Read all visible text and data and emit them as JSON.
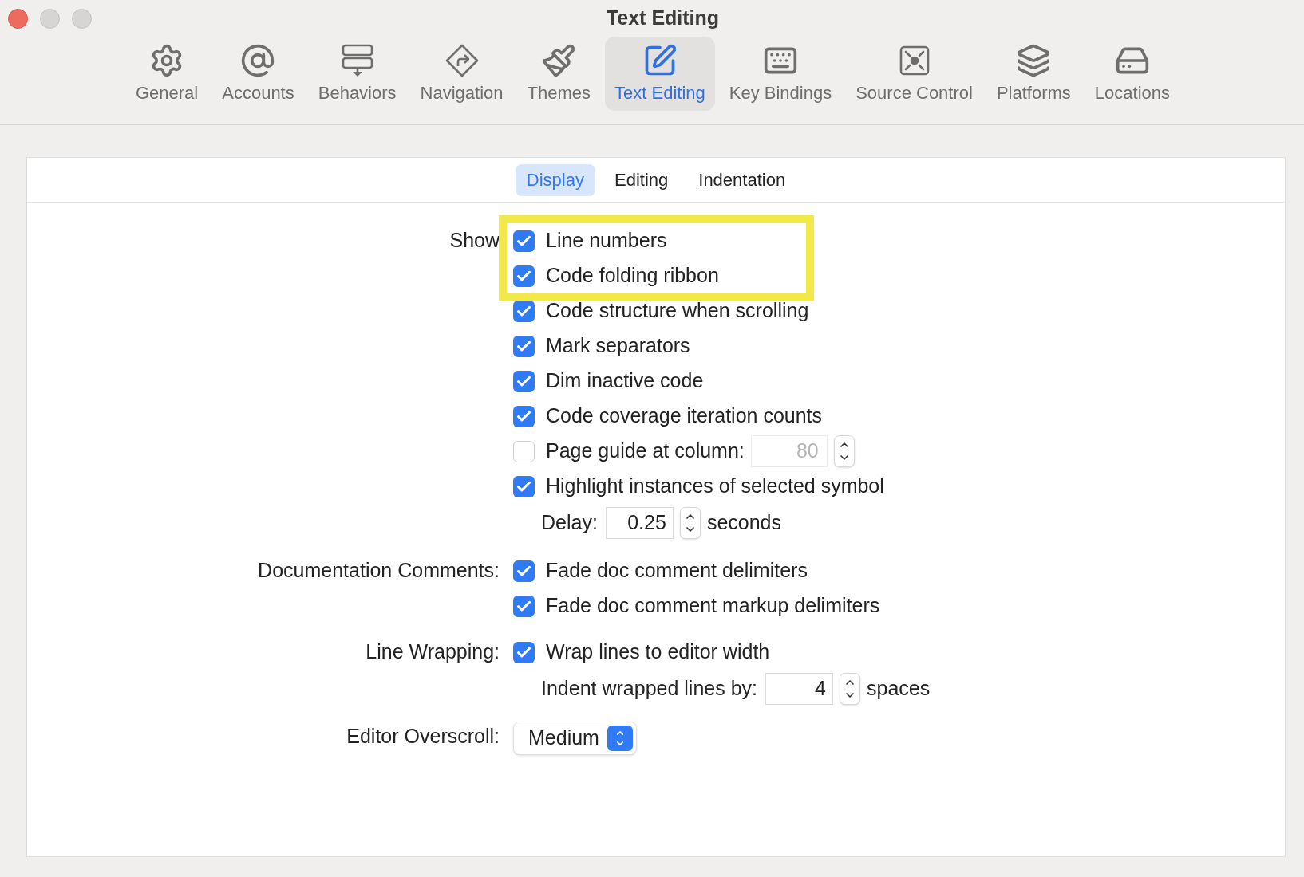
{
  "window": {
    "title": "Text Editing"
  },
  "toolbar": [
    {
      "label": "General",
      "selected": false
    },
    {
      "label": "Accounts",
      "selected": false
    },
    {
      "label": "Behaviors",
      "selected": false
    },
    {
      "label": "Navigation",
      "selected": false
    },
    {
      "label": "Themes",
      "selected": false
    },
    {
      "label": "Text Editing",
      "selected": true
    },
    {
      "label": "Key Bindings",
      "selected": false
    },
    {
      "label": "Source Control",
      "selected": false
    },
    {
      "label": "Platforms",
      "selected": false
    },
    {
      "label": "Locations",
      "selected": false
    }
  ],
  "tabs": [
    {
      "label": "Display",
      "selected": true
    },
    {
      "label": "Editing",
      "selected": false
    },
    {
      "label": "Indentation",
      "selected": false
    }
  ],
  "sections": [
    {
      "label": "Show",
      "items": [
        {
          "kind": "checkbox",
          "label": "Line numbers",
          "checked": true,
          "highlighted": true
        },
        {
          "kind": "checkbox",
          "label": "Code folding ribbon",
          "checked": true,
          "highlighted": true
        },
        {
          "kind": "checkbox",
          "label": "Code structure when scrolling",
          "checked": true,
          "highlighted": false
        },
        {
          "kind": "checkbox",
          "label": "Mark separators",
          "checked": true,
          "highlighted": false
        },
        {
          "kind": "checkbox",
          "label": "Dim inactive code",
          "checked": true,
          "highlighted": false
        },
        {
          "kind": "checkbox",
          "label": "Code coverage iteration counts",
          "checked": true,
          "highlighted": false
        },
        {
          "kind": "checkbox",
          "label": "Page guide at column:",
          "checked": false,
          "highlighted": false,
          "field": {
            "value": "80",
            "disabled": true
          }
        },
        {
          "kind": "checkbox",
          "label": "Highlight instances of selected symbol",
          "checked": true,
          "highlighted": false
        },
        {
          "kind": "stepper",
          "label": "Delay:",
          "value": "0.25",
          "unit": "seconds"
        }
      ]
    },
    {
      "label": "Documentation Comments:",
      "items": [
        {
          "kind": "checkbox",
          "label": "Fade doc comment delimiters",
          "checked": true,
          "highlighted": false
        },
        {
          "kind": "checkbox",
          "label": "Fade doc comment markup delimiters",
          "checked": true,
          "highlighted": false
        }
      ]
    },
    {
      "label": "Line Wrapping:",
      "items": [
        {
          "kind": "checkbox",
          "label": "Wrap lines to editor width",
          "checked": true,
          "highlighted": false
        },
        {
          "kind": "stepper",
          "label": "Indent wrapped lines by:",
          "value": "4",
          "unit": "spaces"
        }
      ]
    },
    {
      "label": "Editor Overscroll:",
      "items": [
        {
          "kind": "popup",
          "value": "Medium"
        }
      ]
    }
  ]
}
